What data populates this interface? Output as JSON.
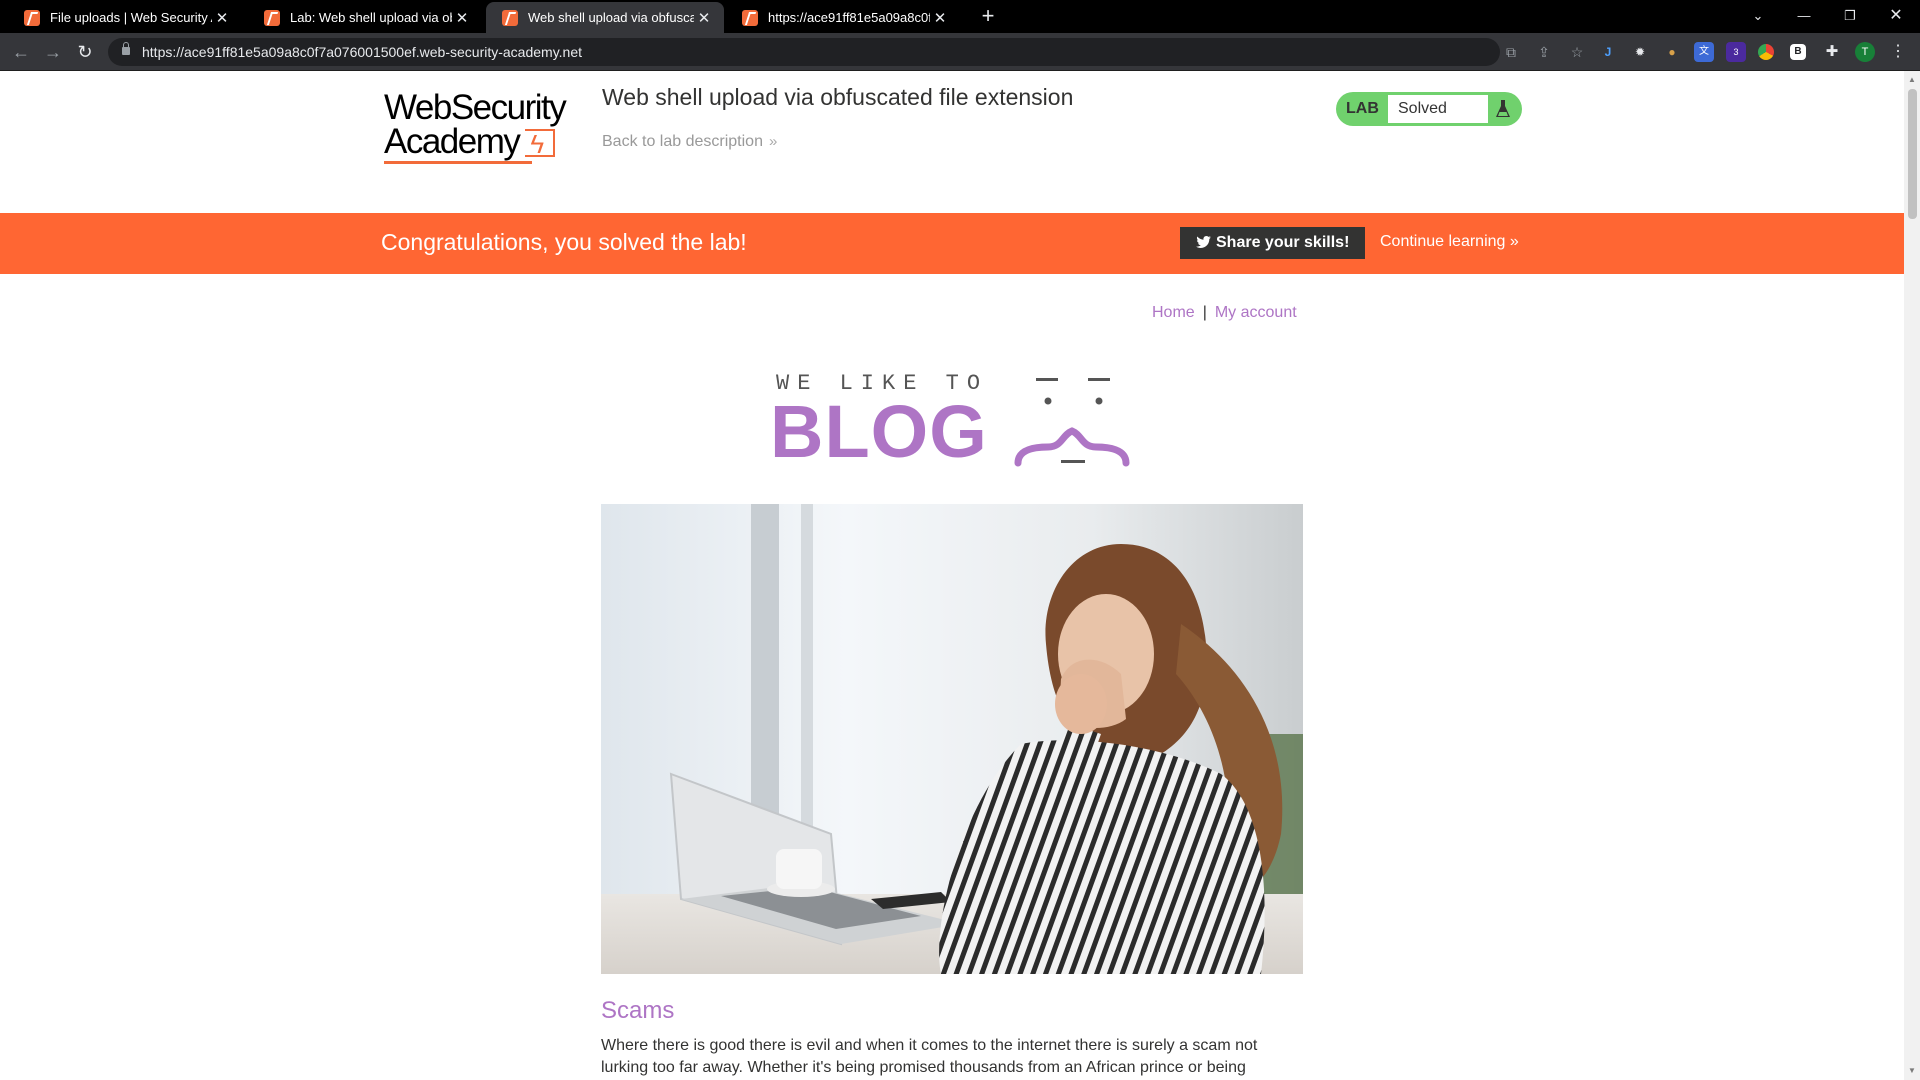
{
  "browser": {
    "tabs": [
      {
        "title": "File uploads | Web Security Acad",
        "active": false
      },
      {
        "title": "Lab: Web shell upload via obfusc",
        "active": false
      },
      {
        "title": "Web shell upload via obfuscated",
        "active": true
      },
      {
        "title": "https://ace91ff81e5a09a8c0f7a07",
        "active": false
      }
    ],
    "url": "https://ace91ff81e5a09a8c0f7a076001500ef.web-security-academy.net",
    "profile_initial": "T",
    "extension_badge": "3"
  },
  "header": {
    "logo_line1": "WebSecurity",
    "logo_line2": "Academy",
    "lab_title": "Web shell upload via obfuscated file extension",
    "back_link": "Back to lab description",
    "lab_tag": "LAB",
    "lab_state": "Solved",
    "status_color": "#70d16d"
  },
  "banner": {
    "message": "Congratulations, you solved the lab!",
    "share_label": "Share your skills!",
    "continue_label": "Continue learning",
    "color": "#ff6633"
  },
  "blog": {
    "nav": {
      "home": "Home",
      "separator": "|",
      "account": "My account"
    },
    "logo_small": "WE LIKE TO",
    "logo_big": "BLOG",
    "accent_color": "#ae75c5",
    "post": {
      "title": "Scams",
      "summary": "Where there is good there is evil and when it comes to the internet there is surely a scam not lurking too far away. Whether it's being promised thousands from an African prince or being"
    }
  }
}
